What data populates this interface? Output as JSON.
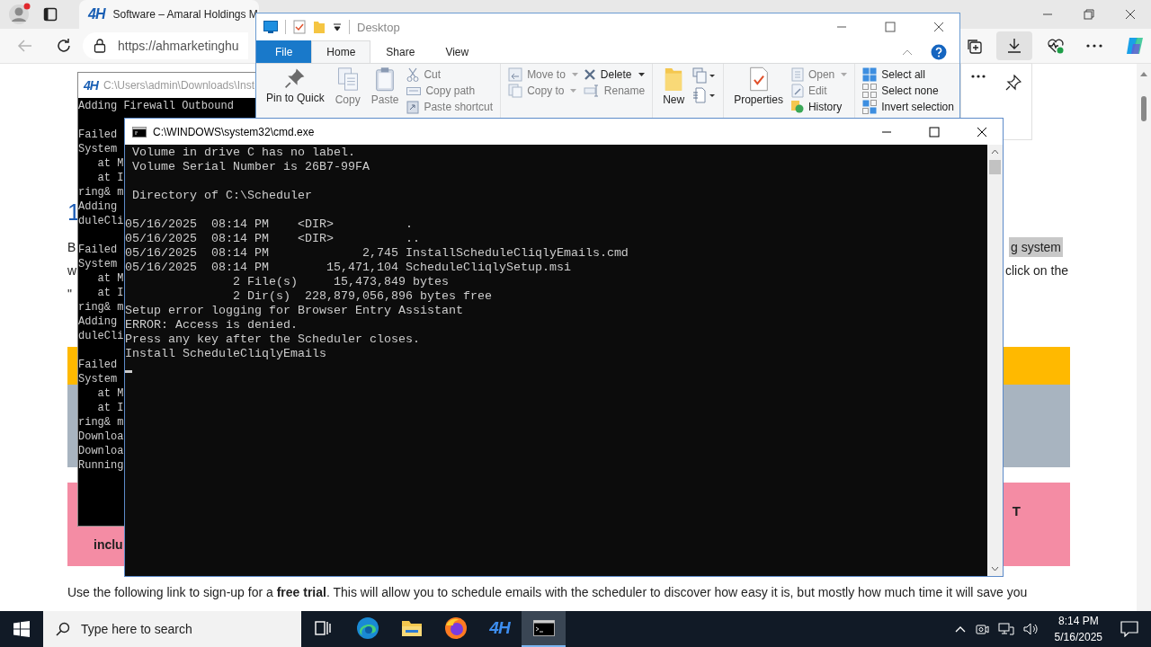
{
  "browser": {
    "tab": {
      "logo": "4H",
      "title": "Software – Amaral Holdings M",
      "selected": true
    },
    "address": "https://ahmarketinghu",
    "page": {
      "heading": "1",
      "rows": [
        {
          "left": "B",
          "right": "g system"
        },
        {
          "left": "w",
          "right": "click on the"
        },
        {
          "left": "\""
        }
      ],
      "notice_right": "T",
      "notice_left": "inclu",
      "footer": "Use the following link to sign-up for a **free trial**. This will allow you to schedule emails with the scheduler to discover how easy it is, but mostly how much time it will save you"
    }
  },
  "console_back": {
    "logo": "4H",
    "title": "C:\\Users\\admin\\Downloads\\Inst",
    "blocks": [
      [
        "Adding Firewall Outbound"
      ],
      [
        "Failed",
        "System",
        "   at M",
        "   at I",
        "ring& m",
        "Adding",
        "duleCli"
      ],
      [
        "Failed",
        "System",
        "   at M",
        "   at I",
        "ring& m",
        "Adding",
        "duleCli"
      ],
      [
        "Failed",
        "System",
        "   at M",
        "   at I",
        "ring& m",
        "Downloa",
        "Downloa",
        "Running"
      ]
    ]
  },
  "explorer": {
    "title": "Desktop",
    "tabs": [
      {
        "label": "File",
        "kind": "file",
        "selected": false
      },
      {
        "label": "Home",
        "kind": "tab",
        "selected": true
      },
      {
        "label": "Share",
        "kind": "tab",
        "selected": false
      },
      {
        "label": "View",
        "kind": "tab",
        "selected": false
      }
    ],
    "ribbon": {
      "pin": {
        "label": "Pin to Quick",
        "disabled": false
      },
      "copy": {
        "label": "Copy",
        "disabled": true
      },
      "paste": {
        "label": "Paste",
        "disabled": true
      },
      "cut": {
        "label": "Cut",
        "disabled": true
      },
      "copy_path": {
        "label": "Copy path",
        "disabled": true
      },
      "paste_shortcut": {
        "label": "Paste shortcut",
        "disabled": true
      },
      "move_to": {
        "label": "Move to",
        "disabled": true
      },
      "copy_to": {
        "label": "Copy to",
        "disabled": true
      },
      "delete": {
        "label": "Delete",
        "disabled": false
      },
      "rename": {
        "label": "Rename",
        "disabled": true
      },
      "new_folder": {
        "label": "New",
        "disabled": false
      },
      "properties": {
        "label": "Properties",
        "disabled": false
      },
      "open": {
        "label": "Open",
        "disabled": true
      },
      "edit": {
        "label": "Edit",
        "disabled": true
      },
      "history": {
        "label": "History",
        "disabled": false
      },
      "select_all": {
        "label": "Select all",
        "disabled": false
      },
      "select_none": {
        "label": "Select none",
        "disabled": false
      },
      "invert": {
        "label": "Invert selection",
        "disabled": false
      }
    }
  },
  "console": {
    "title": "C:\\WINDOWS\\system32\\cmd.exe",
    "blocks": [
      [
        " Volume in drive C has no label.",
        " Volume Serial Number is 26B7-99FA"
      ],
      [
        " Directory of C:\\Scheduler"
      ],
      [
        "05/16/2025  08:14 PM    <DIR>          .",
        "05/16/2025  08:14 PM    <DIR>          ..",
        "05/16/2025  08:14 PM             2,745 InstallScheduleCliqlyEmails.cmd",
        "05/16/2025  08:14 PM        15,471,104 ScheduleCliqlySetup.msi",
        "               2 File(s)     15,473,849 bytes",
        "               2 Dir(s)  228,879,056,896 bytes free",
        "Setup error logging for Browser Entry Assistant",
        "ERROR: Access is denied.",
        "Press any key after the Scheduler closes.",
        "Install ScheduleCliqlyEmails"
      ]
    ]
  },
  "taskbar": {
    "search_placeholder": "Type here to search",
    "apps": [
      {
        "kind": "task-view",
        "selected": false
      },
      {
        "kind": "edge",
        "selected": false
      },
      {
        "kind": "explorer",
        "selected": false
      },
      {
        "kind": "firefox",
        "selected": false
      },
      {
        "kind": "logo",
        "label": "4H",
        "selected": false
      },
      {
        "kind": "console",
        "selected": true
      }
    ],
    "time": "8:14 PM",
    "date": "5/16/2025"
  }
}
